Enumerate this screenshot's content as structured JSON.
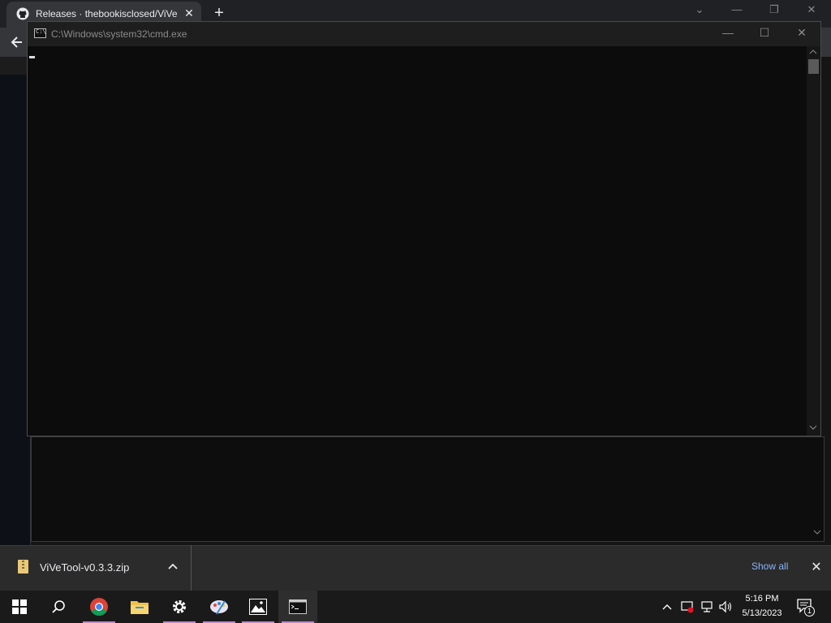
{
  "browser": {
    "tab_title": "Releases · thebookisclosed/ViVe",
    "tab_close": "✕",
    "new_tab": "+",
    "back_icon": "arrow-left-icon",
    "window_controls": {
      "dropdown": "⌄",
      "minimize": "—",
      "restore": "❐",
      "close": "✕"
    }
  },
  "cmd_window": {
    "title": "C:\\Windows\\system32\\cmd.exe",
    "icon_label": "C:\\",
    "controls": {
      "minimize": "—",
      "maximize": "☐",
      "close": "✕"
    },
    "output": ""
  },
  "downloads": {
    "file_name": "ViVeTool-v0.3.3.zip",
    "caret": "⌃",
    "show_all": "Show all",
    "close": "✕"
  },
  "taskbar": {
    "apps": [
      "start",
      "search",
      "chrome",
      "file-explorer",
      "settings",
      "paint",
      "photos",
      "command-prompt"
    ],
    "time": "5:16 PM",
    "date": "5/13/2023",
    "notification_count": "1"
  },
  "colors": {
    "taskbar_active_underline": "#c183d8",
    "link": "#8ab4f8",
    "console_bg": "#0c0c0c"
  }
}
